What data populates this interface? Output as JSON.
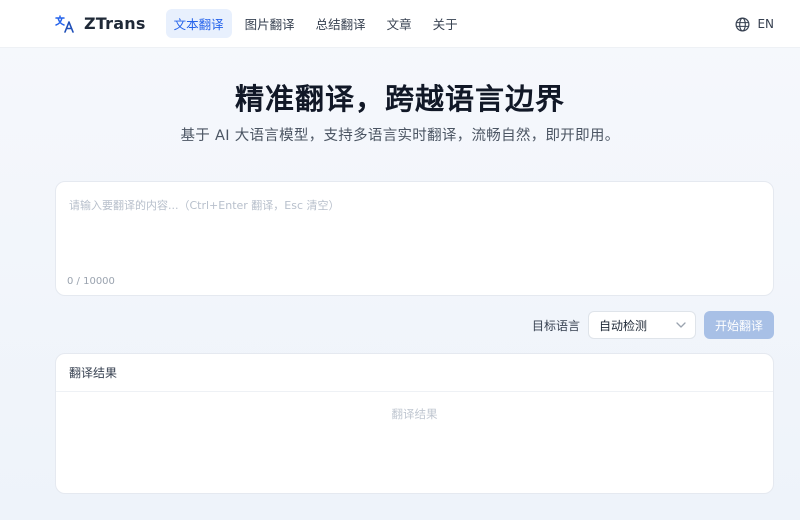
{
  "brand": {
    "name": "ZTrans",
    "icon": "translate-icon"
  },
  "nav": {
    "items": [
      {
        "label": "文本翻译",
        "active": true
      },
      {
        "label": "图片翻译",
        "active": false
      },
      {
        "label": "总结翻译",
        "active": false
      },
      {
        "label": "文章",
        "active": false
      },
      {
        "label": "关于",
        "active": false
      }
    ]
  },
  "language_switch": {
    "label": "EN",
    "icon": "globe-icon"
  },
  "hero": {
    "title": "精准翻译，跨越语言边界",
    "subtitle": "基于 AI 大语言模型，支持多语言实时翻译，流畅自然，即开即用。"
  },
  "input": {
    "value": "",
    "placeholder": "请输入要翻译的内容...（Ctrl+Enter 翻译，Esc 清空）",
    "char_count": "0 / 10000"
  },
  "controls": {
    "target_label": "目标语言",
    "target_value": "自动检测",
    "translate_label": "开始翻译"
  },
  "result": {
    "header": "翻译结果",
    "placeholder": "翻译结果"
  },
  "colors": {
    "accent": "#2563eb",
    "active_nav_bg": "#e8f0fd",
    "button_disabled": "#a8c0e6",
    "background": "#f1f5fb"
  }
}
